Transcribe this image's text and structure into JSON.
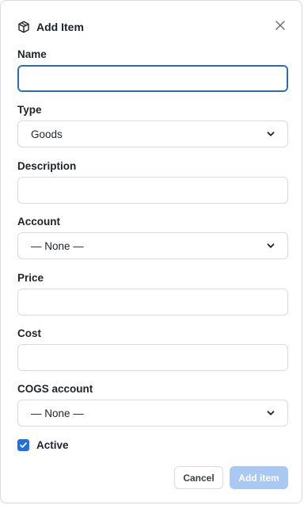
{
  "dialog": {
    "title": "Add Item",
    "title_icon": "box-icon",
    "close_icon": "close-icon"
  },
  "fields": {
    "name": {
      "label": "Name",
      "value": ""
    },
    "type": {
      "label": "Type",
      "selected": "Goods"
    },
    "description": {
      "label": "Description",
      "value": ""
    },
    "account": {
      "label": "Account",
      "selected": "— None —"
    },
    "price": {
      "label": "Price",
      "value": ""
    },
    "cost": {
      "label": "Cost",
      "value": ""
    },
    "cogs_account": {
      "label": "COGS account",
      "selected": "— None —"
    }
  },
  "active": {
    "label": "Active",
    "checked": true
  },
  "actions": {
    "cancel_label": "Cancel",
    "add_label": "Add item"
  },
  "colors": {
    "accent": "#1f6fe5",
    "focus": "#2b6cb0",
    "add_button_disabled": "#a9c8f2"
  }
}
